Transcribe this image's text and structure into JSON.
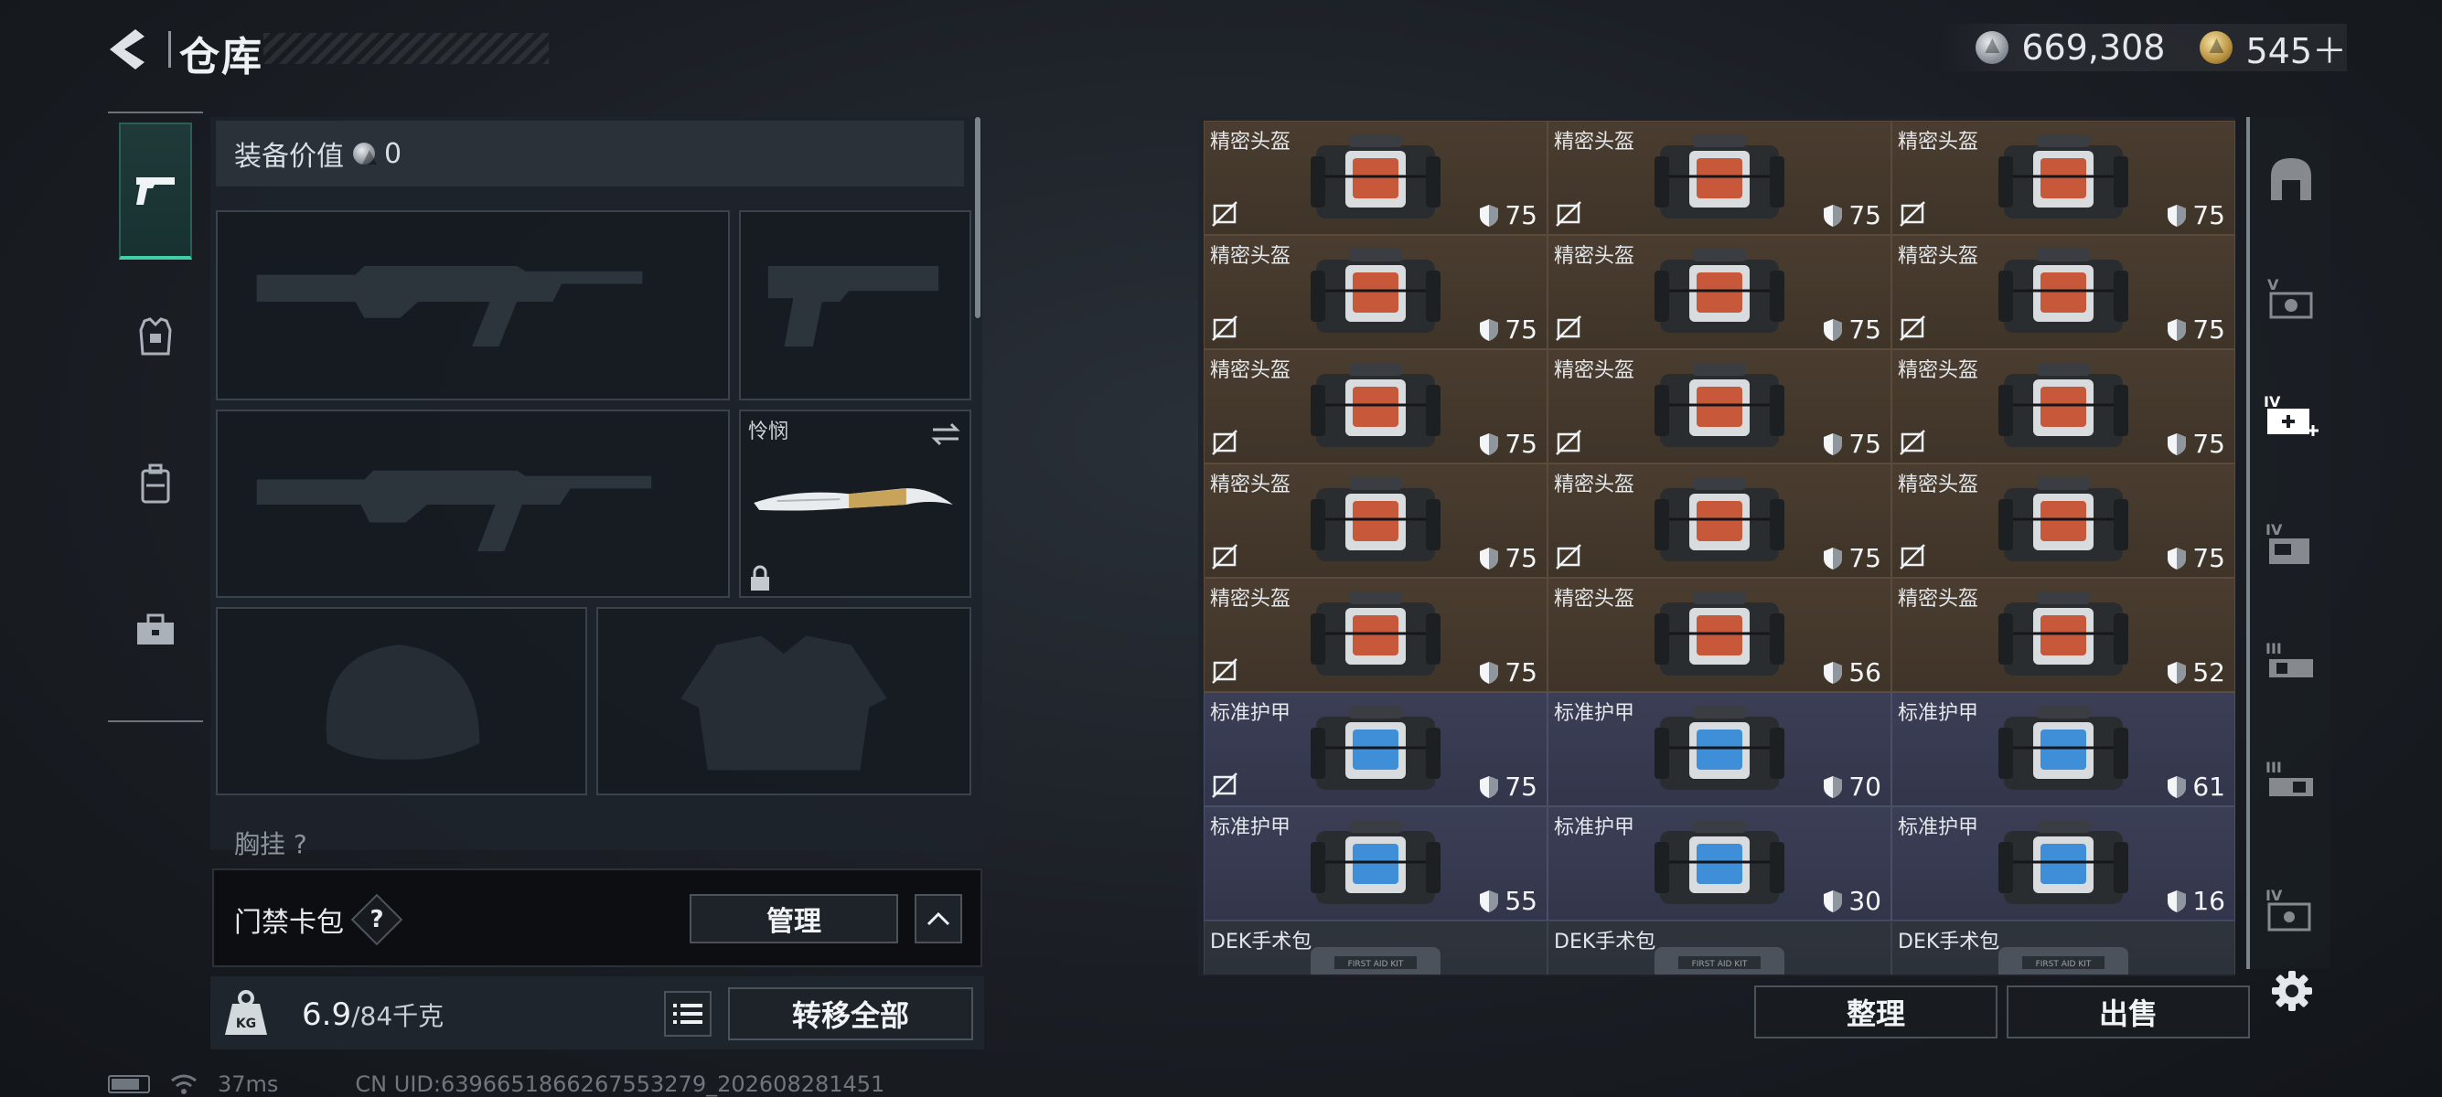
{
  "header": {
    "title": "仓库",
    "currency": [
      {
        "icon": "silver-coin-icon",
        "value": "669,308"
      },
      {
        "icon": "gold-coin-icon",
        "value": "545＋"
      }
    ]
  },
  "equipment": {
    "value_label": "装备价值",
    "value": "0",
    "knife_name": "怜悯",
    "partial_section_label": "胸挂 ?"
  },
  "keycard": {
    "label": "门禁卡包",
    "help": "?",
    "manage_label": "管理"
  },
  "weight": {
    "current": "6.9",
    "capacity": "/84千克",
    "kg_icon_text": "KG",
    "transfer_all_label": "转移全部"
  },
  "status": {
    "ping": "37ms",
    "uid": "CN UID:6396651866267553279_202608281451"
  },
  "storage": {
    "items": [
      {
        "name": "精密头盔",
        "type": "helmet",
        "durability": "75",
        "no_trade": true
      },
      {
        "name": "精密头盔",
        "type": "helmet",
        "durability": "75",
        "no_trade": true
      },
      {
        "name": "精密头盔",
        "type": "helmet",
        "durability": "75",
        "no_trade": true
      },
      {
        "name": "精密头盔",
        "type": "helmet",
        "durability": "75",
        "no_trade": true
      },
      {
        "name": "精密头盔",
        "type": "helmet",
        "durability": "75",
        "no_trade": true
      },
      {
        "name": "精密头盔",
        "type": "helmet",
        "durability": "75",
        "no_trade": true
      },
      {
        "name": "精密头盔",
        "type": "helmet",
        "durability": "75",
        "no_trade": true
      },
      {
        "name": "精密头盔",
        "type": "helmet",
        "durability": "75",
        "no_trade": true
      },
      {
        "name": "精密头盔",
        "type": "helmet",
        "durability": "75",
        "no_trade": true
      },
      {
        "name": "精密头盔",
        "type": "helmet",
        "durability": "75",
        "no_trade": true
      },
      {
        "name": "精密头盔",
        "type": "helmet",
        "durability": "75",
        "no_trade": true
      },
      {
        "name": "精密头盔",
        "type": "helmet",
        "durability": "75",
        "no_trade": true
      },
      {
        "name": "精密头盔",
        "type": "helmet",
        "durability": "75",
        "no_trade": true
      },
      {
        "name": "精密头盔",
        "type": "helmet",
        "durability": "56",
        "no_trade": false
      },
      {
        "name": "精密头盔",
        "type": "helmet",
        "durability": "52",
        "no_trade": false
      },
      {
        "name": "标准护甲",
        "type": "armor",
        "durability": "75",
        "no_trade": true
      },
      {
        "name": "标准护甲",
        "type": "armor",
        "durability": "70",
        "no_trade": false
      },
      {
        "name": "标准护甲",
        "type": "armor",
        "durability": "61",
        "no_trade": false
      },
      {
        "name": "标准护甲",
        "type": "armor",
        "durability": "55",
        "no_trade": false
      },
      {
        "name": "标准护甲",
        "type": "armor",
        "durability": "30",
        "no_trade": false
      },
      {
        "name": "标准护甲",
        "type": "armor",
        "durability": "16",
        "no_trade": false
      },
      {
        "name": "DEK手术包",
        "type": "med",
        "durability": "",
        "no_trade": false
      },
      {
        "name": "DEK手术包",
        "type": "med",
        "durability": "",
        "no_trade": false
      },
      {
        "name": "DEK手术包",
        "type": "med",
        "durability": "",
        "no_trade": false
      }
    ],
    "sort_label": "整理",
    "sell_label": "出售"
  },
  "filters": [
    {
      "icon": "helmet-filter-icon",
      "label": ""
    },
    {
      "icon": "helmet-tier-v-icon",
      "label": "V"
    },
    {
      "icon": "armor-tier-iv-plus-icon",
      "label": "IV"
    },
    {
      "icon": "armor-tier-iv-icon",
      "label": "IV"
    },
    {
      "icon": "armor-tier-iii-icon",
      "label": "III"
    },
    {
      "icon": "armor-tier-iii-alt-icon",
      "label": "III"
    },
    {
      "icon": "armor-tier-iv-alt-icon",
      "label": "IV"
    }
  ],
  "colors": {
    "accent_green": "#3fd0a8",
    "helmet_cell": "#4a3d30",
    "armor_cell": "#3b3e55"
  }
}
